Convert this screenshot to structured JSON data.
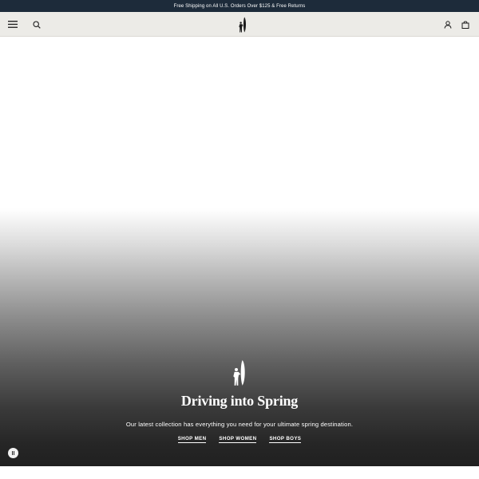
{
  "announcement": {
    "text": "Free Shipping on All U.S. Orders Over $125 & Free Returns"
  },
  "header": {
    "menu_icon": "hamburger-menu-icon",
    "search_icon": "search-icon",
    "logo_icon": "surfer-with-surfboard-logo",
    "account_icon": "user-icon",
    "cart_icon": "shopping-bag-icon"
  },
  "hero": {
    "logo_icon": "surfer-with-surfboard-logo",
    "title": "Driving into Spring",
    "subtitle": "Our latest collection has everything you need for your ultimate spring destination.",
    "ctas": [
      {
        "label": "SHOP MEN"
      },
      {
        "label": "SHOP WOMEN"
      },
      {
        "label": "SHOP BOYS"
      }
    ],
    "pause_icon": "pause-icon"
  },
  "colors": {
    "announcement_bg": "#1d2b3a",
    "header_bg": "#ecebe7",
    "hero_text": "#ffffff"
  }
}
